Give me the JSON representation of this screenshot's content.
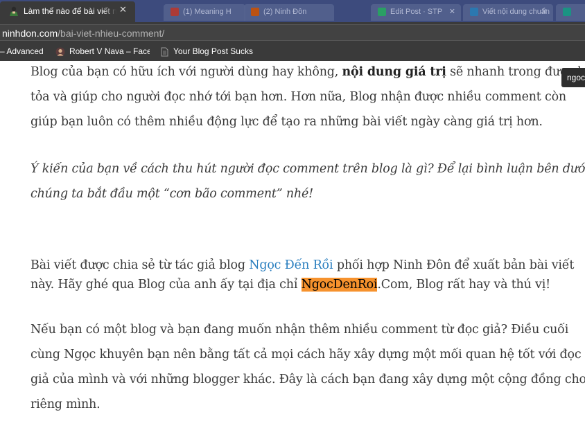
{
  "browser": {
    "active_tab": {
      "title": "Làm thế nào để bài viết nhận được nhiều comment",
      "favicon": "avatar-icon"
    },
    "background_tabs": [
      {
        "title": "(1) Meaning H",
        "favicon": "generic-icon",
        "color": "#c0392b"
      },
      {
        "title": "(2) Ninh Đôn",
        "favicon": "generic-icon",
        "color": "#d35400"
      },
      {
        "title": "Edit Post · STP",
        "favicon": "generic-icon",
        "color": "#27ae60"
      },
      {
        "title": "Viết nội dung chuẩn",
        "favicon": "generic-icon",
        "color": "#2980b9"
      }
    ],
    "url_domain": "ninhdon.com",
    "url_path": "/bai-viet-nhieu-comment/",
    "bookmarks": [
      {
        "label": "– Advanced",
        "icon": "doc-icon"
      },
      {
        "label": "Robert V Nava – Facebook",
        "icon": "avatar-icon"
      },
      {
        "label": "Your Blog Post Sucks",
        "icon": "doc-icon"
      }
    ]
  },
  "article": {
    "p1": {
      "l1_a": "Blog của bạn có hữu ích với người dùng hay không, ",
      "l1_b": "nội dung giá trị",
      "l1_c": " sẽ nhanh trong được lan",
      "l2": "tỏa và giúp cho người đọc nhớ tới bạn hơn. Hơn nữa, Blog nhận được nhiều comment còn",
      "l3": "giúp bạn luôn có thêm nhiều động lực để tạo ra những bài viết ngày càng giá trị hơn."
    },
    "p2": {
      "l1": "Ý kiến của bạn về cách thu hút người đọc comment trên blog là gì? Để lại bình luận bên dưới để",
      "l2": "chúng ta bắt đầu một “cơn bão comment” nhé!"
    },
    "p3": {
      "l1_a": "Bài viết được chia sẻ từ tác giả blog ",
      "l1_link": "Ngọc Đến Rồi",
      "l1_c": " phối hợp Ninh Đôn để xuất bản bài viết",
      "l2_a": "này. Hãy ghé qua Blog của anh ấy tại địa chỉ ",
      "l2_hl": "NgocDenRoi",
      "l2_c": ".Com, Blog rất hay và thú vị!"
    },
    "p4": {
      "l1": "Nếu bạn có một blog và bạn đang muốn nhận thêm nhiều comment từ đọc giả? Điều cuối",
      "l2": "cùng Ngọc khuyên bạn nên bằng tất cả mọi cách hãy xây dựng một mối quan hệ tốt với đọc",
      "l3": "giả của mình và với những blogger khác.  Đây là cách bạn đang xây dựng một cộng đồng cho",
      "l4": "riêng mình."
    }
  },
  "tooltip": {
    "text": "ngoc"
  },
  "colors": {
    "link": "#2b7fbf",
    "highlight": "#f6922d",
    "tabstrip": "#3d4b7d",
    "chrome": "#3a3a3a"
  }
}
